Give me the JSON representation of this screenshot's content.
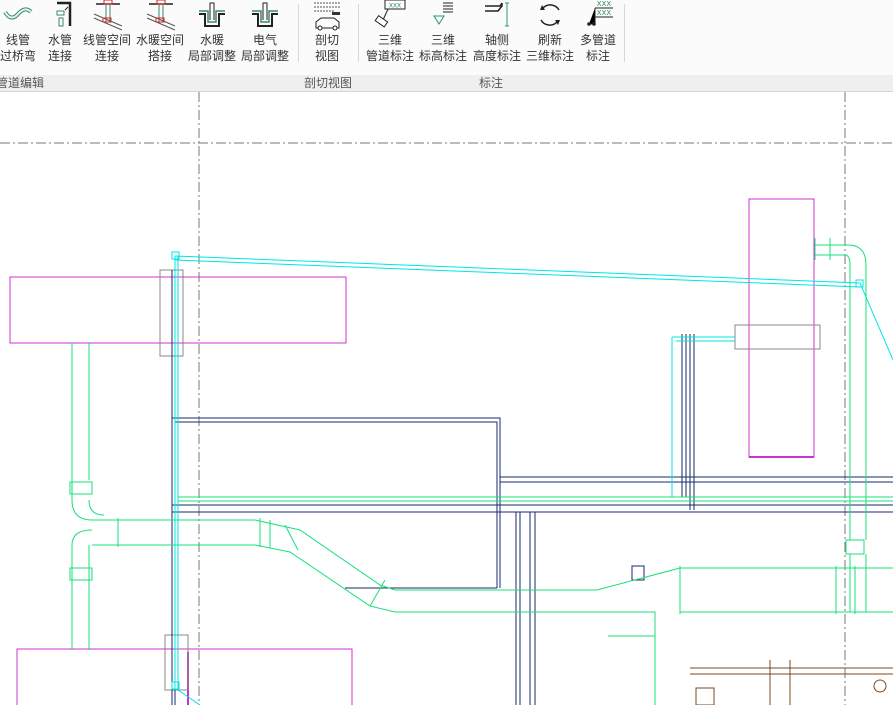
{
  "ribbon": {
    "buttons": [
      {
        "id": "conduit-bridge",
        "line1": "线管",
        "line2": "过桥弯",
        "icon": "conduit-bridge-icon"
      },
      {
        "id": "water-pipe-connect",
        "line1": "水管",
        "line2": "连接",
        "icon": "water-pipe-connect-icon"
      },
      {
        "id": "conduit-space-connect",
        "line1": "线管空间",
        "line2": "连接",
        "icon": "conduit-space-connect-icon"
      },
      {
        "id": "hvac-space-join",
        "line1": "水暖空间",
        "line2": "搭接",
        "icon": "hvac-space-join-icon"
      },
      {
        "id": "hvac-local-adjust",
        "line1": "水暖",
        "line2": "局部调整",
        "icon": "hvac-local-adjust-icon"
      },
      {
        "id": "electric-local-adjust",
        "line1": "电气",
        "line2": "局部调整",
        "icon": "electric-local-adjust-icon"
      },
      {
        "id": "section-view",
        "line1": "剖切",
        "line2": "视图",
        "icon": "section-view-icon"
      },
      {
        "id": "3d-pipe-annotation",
        "line1": "三维",
        "line2": "管道标注",
        "icon": "pipe-annotation-icon"
      },
      {
        "id": "3d-elevation-annotation",
        "line1": "三维",
        "line2": "标高标注",
        "icon": "elevation-annotation-icon"
      },
      {
        "id": "axonometric-height-annotation",
        "line1": "轴侧",
        "line2": "高度标注",
        "icon": "height-annotation-icon"
      },
      {
        "id": "refresh-3d-annotation",
        "line1": "刷新",
        "line2": "三维标注",
        "icon": "refresh-icon"
      },
      {
        "id": "multi-pipe-annotation",
        "line1": "多管道",
        "line2": "标注",
        "icon": "multi-pipe-annotation-icon"
      }
    ],
    "groups": [
      "管道编辑",
      "剖切视图",
      "标注"
    ],
    "icon_text": "XXX"
  },
  "colors": {
    "cyan": "#00e5e5",
    "green": "#19e07a",
    "magenta": "#cc33cc",
    "navy": "#1a2a6e",
    "grey": "#808080",
    "brown": "#7a4a1e"
  }
}
